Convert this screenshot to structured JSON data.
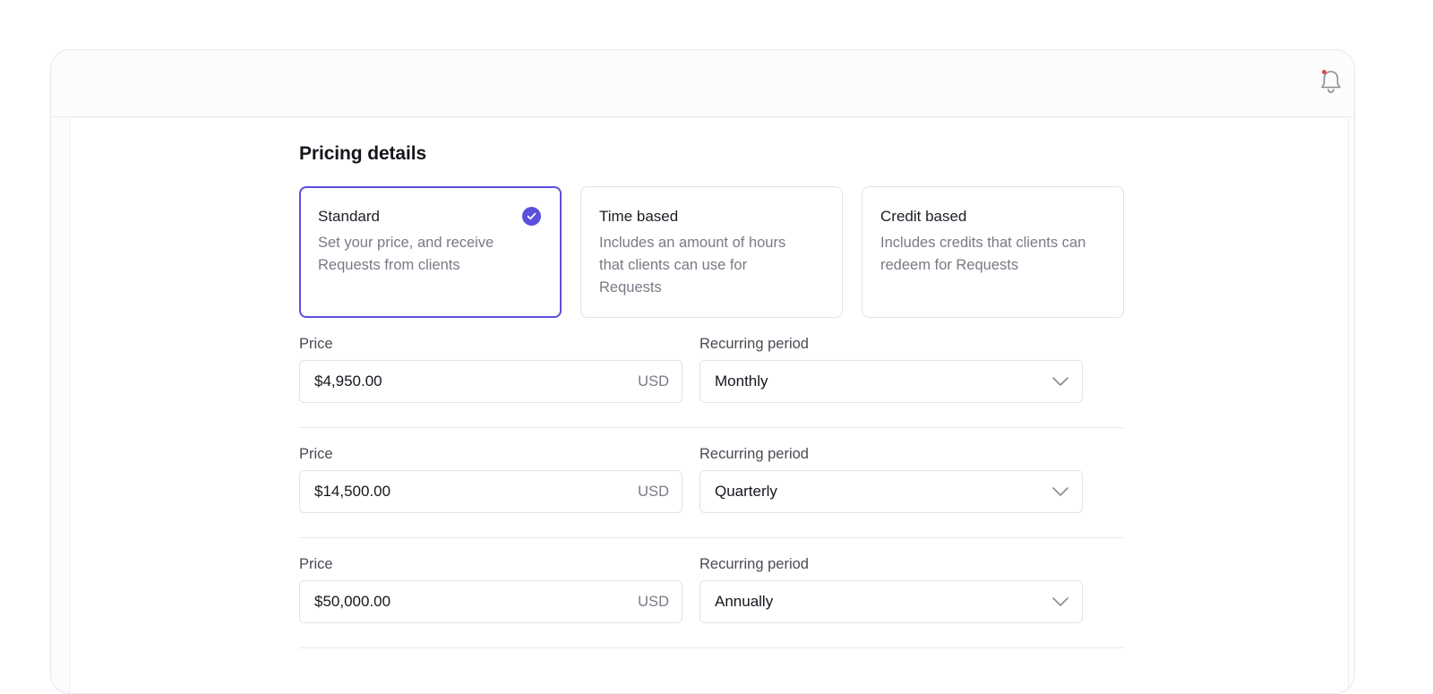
{
  "header": {
    "notification_icon": "bell-icon",
    "has_unread": true,
    "unread_color": "#e5484d"
  },
  "pricing": {
    "title": "Pricing details",
    "accent_color": "#5b4fdc",
    "plans": [
      {
        "title": "Standard",
        "description": "Set your price, and receive Requests from clients",
        "selected": true
      },
      {
        "title": "Time based",
        "description": "Includes an amount of hours that clients can use for Requests",
        "selected": false
      },
      {
        "title": "Credit based",
        "description": "Includes credits that clients can redeem for Requests",
        "selected": false
      }
    ],
    "rows": [
      {
        "price_label": "Price",
        "price": "$4,950.00",
        "currency": "USD",
        "period_label": "Recurring period",
        "period": "Monthly"
      },
      {
        "price_label": "Price",
        "price": "$14,500.00",
        "currency": "USD",
        "period_label": "Recurring period",
        "period": "Quarterly"
      },
      {
        "price_label": "Price",
        "price": "$50,000.00",
        "currency": "USD",
        "period_label": "Recurring period",
        "period": "Annually"
      }
    ]
  }
}
